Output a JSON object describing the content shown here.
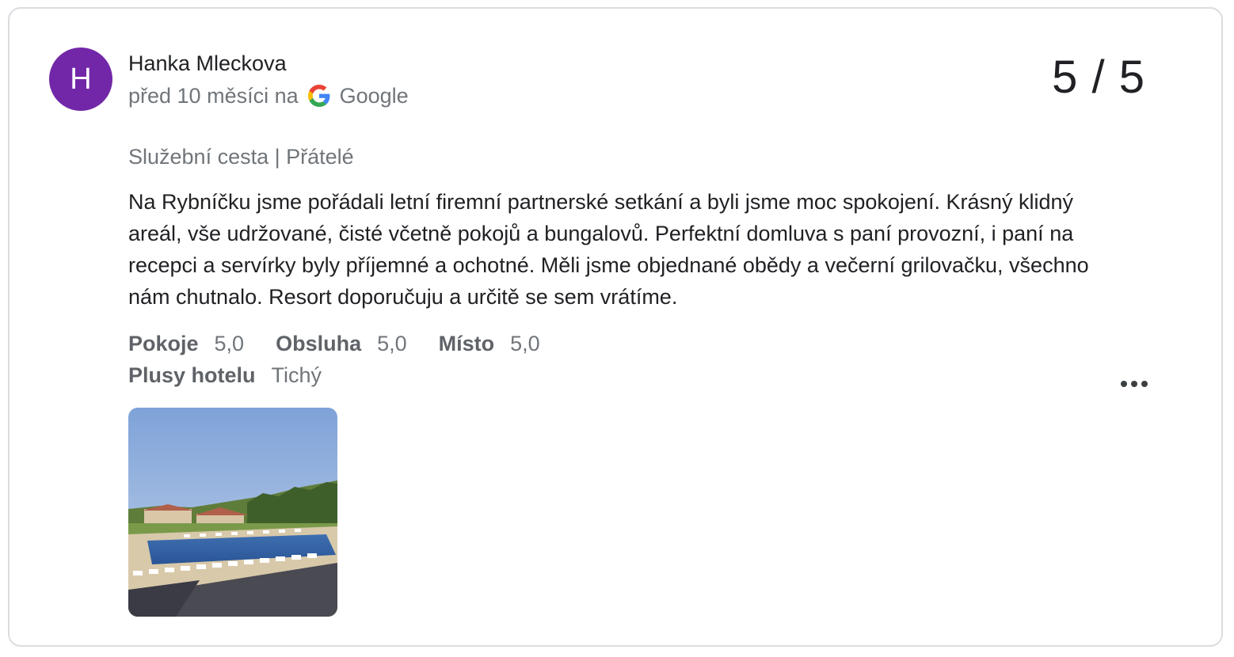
{
  "review": {
    "avatar_letter": "H",
    "avatar_color": "#7227a8",
    "author_name": "Hanka Mleckova",
    "time_ago": "před 10 měsíci na",
    "source_name": "Google",
    "source_icon": "google-icon",
    "score": "5 / 5",
    "trip_type": "Služební cesta | Přátelé",
    "text": "Na Rybníčku jsme pořádali letní firemní partnerské setkání a byli jsme moc spokojení. Krásný klidný areál, vše udržované, čisté včetně pokojů a bungalovů. Perfektní domluva s paní provozní, i paní na recepci a servírky byly příjemné a ochotné. Měli jsme objednané obědy a večerní grilovačku, všechno nám chutnalo. Resort doporučuju a určitě se sem vrátíme.",
    "ratings": [
      {
        "label": "Pokoje",
        "value": "5,0"
      },
      {
        "label": "Obsluha",
        "value": "5,0"
      },
      {
        "label": "Místo",
        "value": "5,0"
      }
    ],
    "highlights": {
      "label": "Plusy hotelu",
      "value": "Tichý"
    },
    "more_icon": "more-horizontal-icon",
    "photo_icon": "review-photo"
  }
}
